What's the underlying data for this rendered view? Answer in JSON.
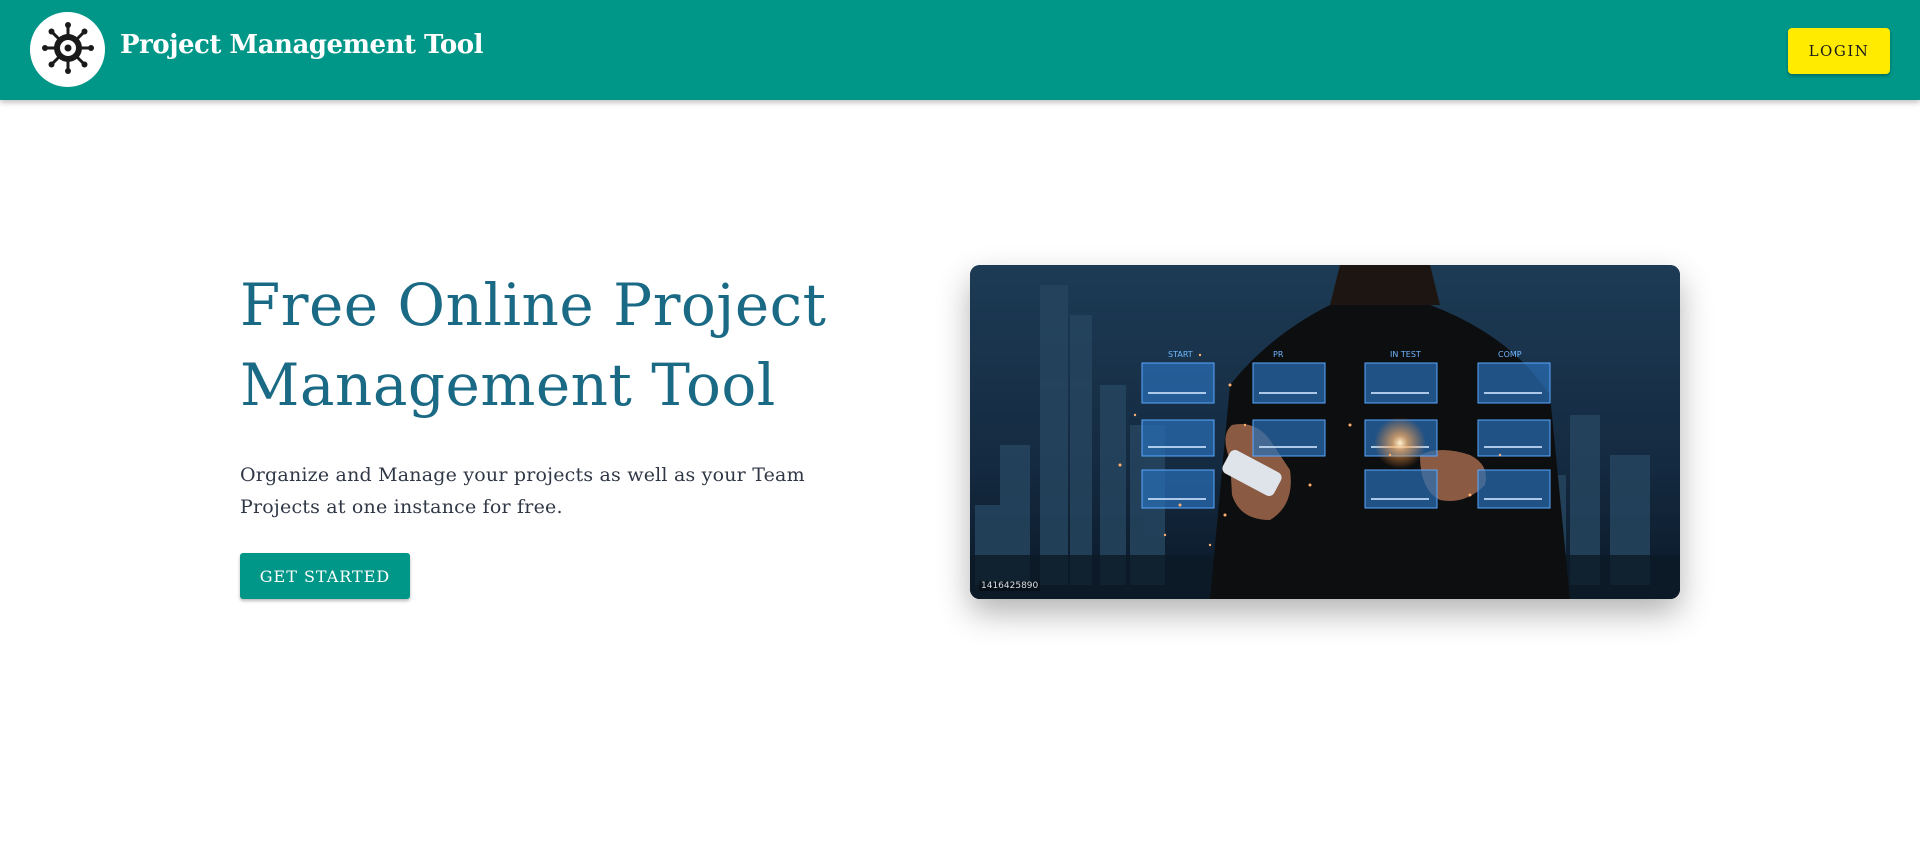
{
  "header": {
    "brand": "Project Management Tool",
    "logo_icon": "virus-gear-icon",
    "login_label": "LOGIN",
    "bg_color": "#009688",
    "login_color": "#ffeb00"
  },
  "hero": {
    "title": "Free Online Project Management Tool",
    "subtitle": "Organize and Manage your projects as well as your Team Projects at one instance for free.",
    "cta_label": "GET STARTED",
    "title_color": "#1a6a85"
  },
  "image": {
    "stock_id": "1416425890",
    "board_columns": [
      "START",
      "PR",
      "IN TEST",
      "COMP"
    ]
  }
}
